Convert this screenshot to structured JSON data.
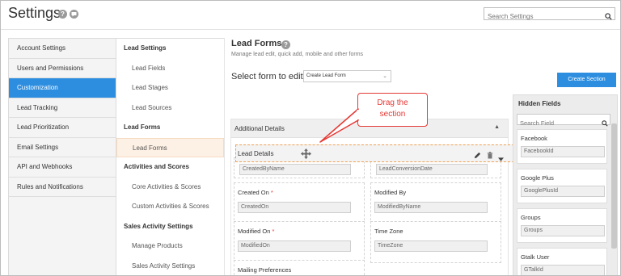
{
  "header": {
    "title": "Settings",
    "search_placeholder": "Search Settings"
  },
  "left_nav": [
    {
      "label": "Account Settings"
    },
    {
      "label": "Users and Permissions"
    },
    {
      "label": "Customization",
      "active": true
    },
    {
      "label": "Lead Tracking"
    },
    {
      "label": "Lead Prioritization"
    },
    {
      "label": "Email Settings"
    },
    {
      "label": "API and Webhooks"
    },
    {
      "label": "Rules and Notifications"
    }
  ],
  "sub_nav": [
    {
      "label": "Lead Settings",
      "kind": "section"
    },
    {
      "label": "Lead Fields",
      "kind": "item"
    },
    {
      "label": "Lead Stages",
      "kind": "item"
    },
    {
      "label": "Lead Sources",
      "kind": "item"
    },
    {
      "label": "Lead Forms",
      "kind": "section"
    },
    {
      "label": "Lead Forms",
      "kind": "item",
      "active": true
    },
    {
      "label": "Activities and Scores",
      "kind": "section"
    },
    {
      "label": "Core Activities & Scores",
      "kind": "item"
    },
    {
      "label": "Custom Activities & Scores",
      "kind": "item"
    },
    {
      "label": "Sales Activity Settings",
      "kind": "section"
    },
    {
      "label": "Manage Products",
      "kind": "item"
    },
    {
      "label": "Sales Activity Settings",
      "kind": "item"
    }
  ],
  "main": {
    "title": "Lead Forms",
    "subtitle": "Manage lead edit, quick add, mobile and other forms",
    "select_label": "Select form to edit",
    "select_value": "Create Lead Form",
    "create_section_label": "Create Section"
  },
  "form": {
    "section_header": "Additional Details",
    "dragging_section": "Lead Details",
    "fields": [
      {
        "label": "Created On",
        "required": true,
        "value": "CreatedOn"
      },
      {
        "label": "Modified By",
        "required": false,
        "value": "ModifiedByName"
      },
      {
        "label": "Modified On",
        "required": true,
        "value": "ModifiedOn"
      },
      {
        "label": "Time Zone",
        "required": false,
        "value": "TimeZone"
      },
      {
        "label": "Mailing Preferences",
        "required": false,
        "value": ""
      }
    ],
    "partial_values": [
      "CreatedByName",
      "LeadConversionDate"
    ]
  },
  "callout": {
    "line1": "Drag the",
    "line2": "section"
  },
  "hidden_fields": {
    "title": "Hidden Fields",
    "search_placeholder": "Search Field",
    "items": [
      {
        "label": "Facebook",
        "value": "FacebookId"
      },
      {
        "label": "Google Plus",
        "value": "GooglePlusId"
      },
      {
        "label": "Groups",
        "value": "Groups"
      },
      {
        "label": "Gtalk User",
        "value": "GTalkId"
      }
    ]
  },
  "colors": {
    "accent": "#2d8ee0",
    "callout": "#e53935",
    "drag_border": "#f0a050"
  }
}
